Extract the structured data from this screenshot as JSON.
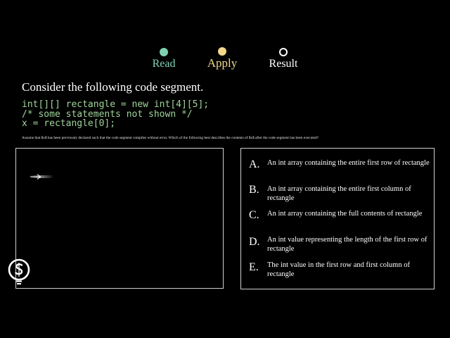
{
  "steps": [
    {
      "label": "Read",
      "state": "complete",
      "color": "#7fd1b0"
    },
    {
      "label": "Apply",
      "state": "current",
      "color": "#f3d88a"
    },
    {
      "label": "Result",
      "state": "pending",
      "color": "#ffffff"
    }
  ],
  "question": {
    "prompt": "Consider the following code segment.",
    "code_lines": [
      "int[][] rectangle = new int[4][5];",
      "/* some statements not shown */",
      "x = rectangle[0];"
    ],
    "fine_print": "Assume that $x$ has been previously declared such that the code segment compiles without error. Which of the following best describes the contents of $x$ after the code segment has been executed?"
  },
  "choices": [
    {
      "letter": "A.",
      "text": "An int array containing the entire first row of rectangle"
    },
    {
      "letter": "B.",
      "text": "An int array containing the entire first column of rectangle"
    },
    {
      "letter": "C.",
      "text": "An int array containing the full contents of rectangle"
    },
    {
      "letter": "D.",
      "text": "An int value representing the length of the first row of rectangle"
    },
    {
      "letter": "E.",
      "text": "The int value in the first row and first column of rectangle"
    }
  ],
  "icons": {
    "work_panel": "arrow-right-icon",
    "logo": "cs-lightbulb-logo-icon"
  },
  "colors": {
    "background": "#000000",
    "code": "#9fd49a",
    "read": "#7fd1b0",
    "apply": "#f3d88a",
    "border": "#cfcfcf"
  }
}
